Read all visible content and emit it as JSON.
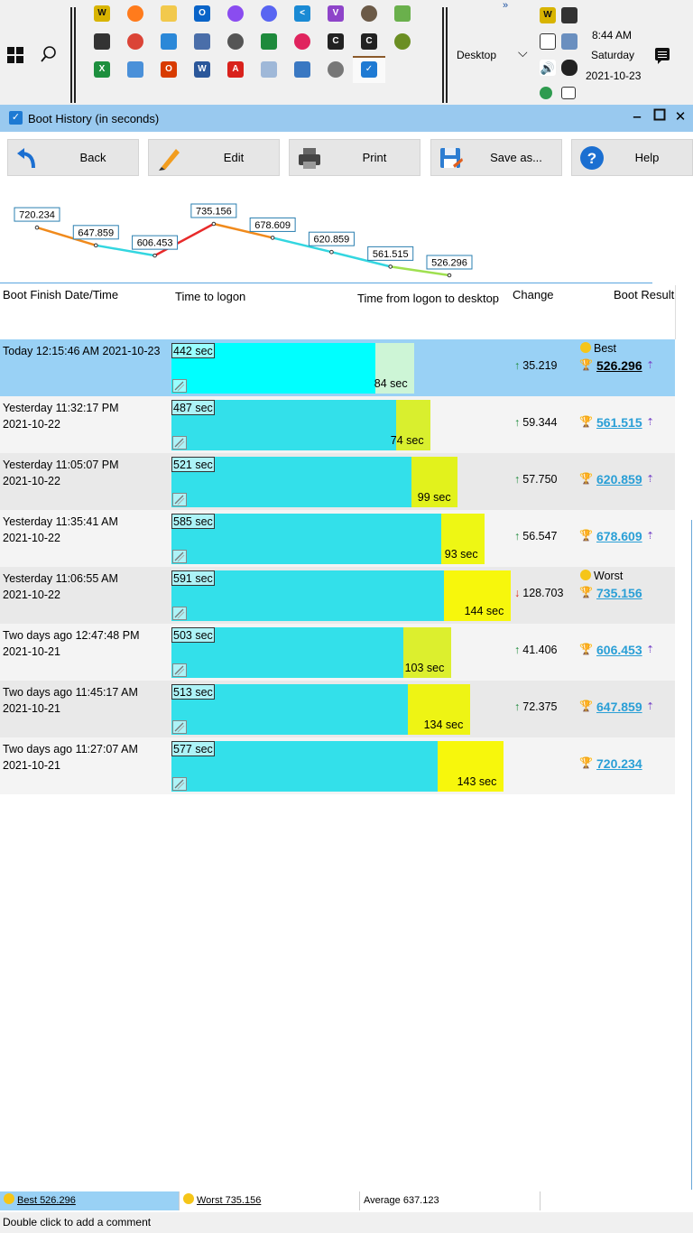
{
  "taskbar": {
    "desktop_label": "Desktop",
    "more_label": "»",
    "clock_time": "8:44 AM",
    "clock_day": "Saturday",
    "clock_date": "2021-10-23"
  },
  "window": {
    "title": "Boot History (in seconds)"
  },
  "toolbar": {
    "back_label": "Back",
    "edit_label": "Edit",
    "print_label": "Print",
    "save_label": "Save as...",
    "help_label": "Help"
  },
  "chart_data": {
    "type": "line",
    "x": [
      "2021-10-21 11:27:07 AM",
      "2021-10-21 11:45:17 AM",
      "2021-10-21 12:47:48 PM",
      "2021-10-22 11:06:55 AM",
      "2021-10-22 11:35:41 AM",
      "2021-10-22 11:05:07 PM",
      "2021-10-22 11:32:17 PM",
      "2021-10-23 12:15:46 AM"
    ],
    "values": [
      720.234,
      647.859,
      606.453,
      735.156,
      678.609,
      620.859,
      561.515,
      526.296
    ],
    "data_labels": [
      "720.234",
      "647.859",
      "606.453",
      "735.156",
      "678.609",
      "620.859",
      "561.515",
      "526.296"
    ]
  },
  "columns": {
    "finish": "Boot Finish Date/Time",
    "logon": "Time to logon",
    "desktop": "Time from logon to desktop",
    "change": "Change",
    "result": "Boot Result"
  },
  "rows": [
    {
      "when1": "Today  12:15:46 AM 2021-10-23",
      "when2": "",
      "logon": 442,
      "logon_label": "442 sec",
      "desk": 84,
      "desk_label": "84 sec",
      "change": "35.219",
      "dir": "up",
      "tag": "Best",
      "result": "526.296",
      "rocket": true,
      "selected": true,
      "desk_color": "#cdf5d6"
    },
    {
      "when1": "Yesterday  11:32:17 PM",
      "when2": "2021-10-22",
      "logon": 487,
      "logon_label": "487 sec",
      "desk": 74,
      "desk_label": "74 sec",
      "change": "59.344",
      "dir": "up",
      "tag": "",
      "result": "561.515",
      "rocket": true,
      "desk_color": "#d9ef2e"
    },
    {
      "when1": "Yesterday  11:05:07 PM",
      "when2": "2021-10-22",
      "logon": 521,
      "logon_label": "521 sec",
      "desk": 99,
      "desk_label": "99 sec",
      "change": "57.750",
      "dir": "up",
      "tag": "",
      "result": "620.859",
      "rocket": true,
      "desk_color": "#e2f21c"
    },
    {
      "when1": "Yesterday  11:35:41 AM",
      "when2": "2021-10-22",
      "logon": 585,
      "logon_label": "585 sec",
      "desk": 93,
      "desk_label": "93 sec",
      "change": "56.547",
      "dir": "up",
      "tag": "",
      "result": "678.609",
      "rocket": true,
      "desk_color": "#eef714"
    },
    {
      "when1": "Yesterday  11:06:55 AM",
      "when2": "2021-10-22",
      "logon": 591,
      "logon_label": "591 sec",
      "desk": 144,
      "desk_label": "144 sec",
      "change": "128.703",
      "dir": "down",
      "tag": "Worst",
      "result": "735.156",
      "rocket": false,
      "desk_color": "#f7f70c"
    },
    {
      "when1": "Two days ago  12:47:48 PM",
      "when2": "2021-10-21",
      "logon": 503,
      "logon_label": "503 sec",
      "desk": 103,
      "desk_label": "103 sec",
      "change": "41.406",
      "dir": "up",
      "tag": "",
      "result": "606.453",
      "rocket": true,
      "desk_color": "#dcef2e"
    },
    {
      "when1": "Two days ago  11:45:17 AM",
      "when2": "2021-10-21",
      "logon": 513,
      "logon_label": "513 sec",
      "desk": 134,
      "desk_label": "134 sec",
      "change": "72.375",
      "dir": "up",
      "tag": "",
      "result": "647.859",
      "rocket": true,
      "desk_color": "#eef414"
    },
    {
      "when1": "Two days ago  11:27:07 AM",
      "when2": "2021-10-21",
      "logon": 577,
      "logon_label": "577 sec",
      "desk": 143,
      "desk_label": "143 sec",
      "change": "",
      "dir": "",
      "tag": "",
      "result": "720.234",
      "rocket": false,
      "desk_color": "#f7f70c"
    }
  ],
  "status": {
    "best": "Best 526.296",
    "worst": "Worst 735.156",
    "average": "Average 637.123",
    "hint": "Double click to add a comment"
  },
  "colors": {
    "selected_row": "#99d1f5",
    "logon_bar": "#33e0ea",
    "logon_bar_selected": "#00ffff",
    "link": "#2a9fd6"
  }
}
